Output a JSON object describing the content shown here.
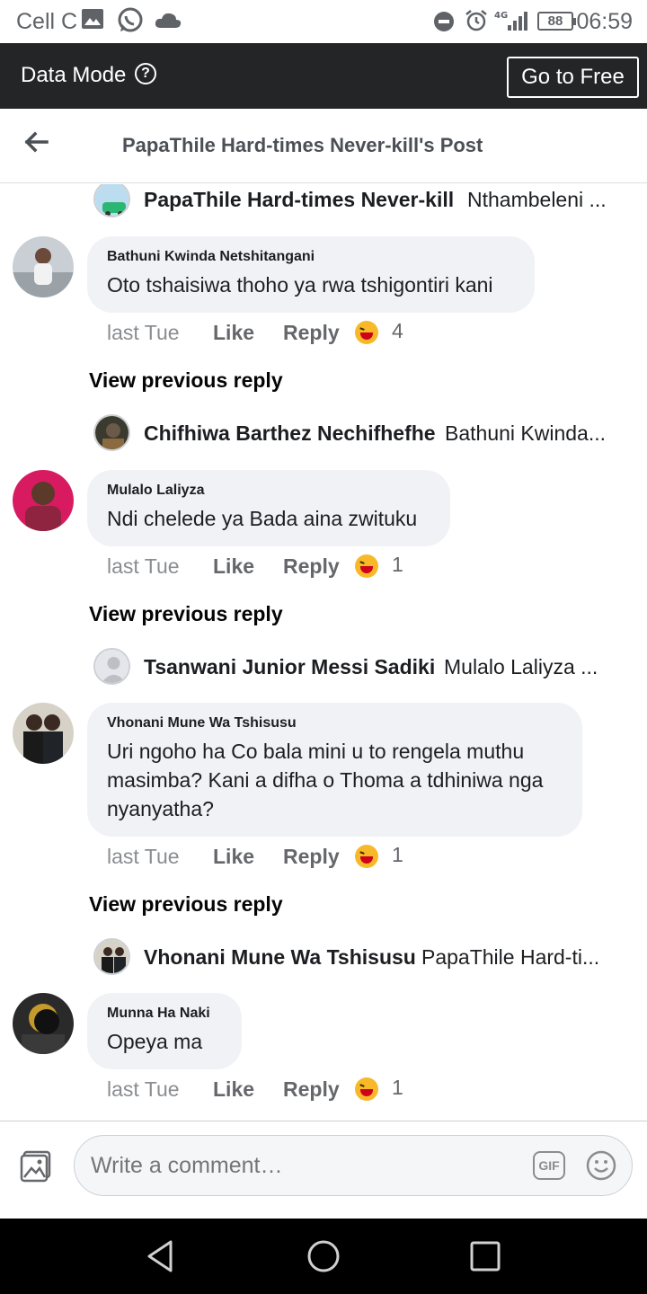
{
  "status_bar": {
    "carrier": "Cell C",
    "battery": "88",
    "network": "4G",
    "time": "06:59"
  },
  "data_mode": {
    "label": "Data Mode",
    "help": "?",
    "button": "Go to Free"
  },
  "header": {
    "title": "PapaThile Hard-times Never-kill's Post"
  },
  "comments": [
    {
      "reply_preview": {
        "name": "PapaThile Hard-times Never-kill",
        "text": "Nthambeleni ..."
      },
      "author": "Bathuni Kwinda Netshitangani",
      "text": "Oto tshaisiwa thoho ya rwa tshigontiri kani",
      "time": "last Tue",
      "like": "Like",
      "reply": "Reply",
      "reactions": "4"
    },
    {
      "view_previous": "View previous reply",
      "reply_preview": {
        "name": "Chifhiwa Barthez Nechifhefhe",
        "text": "Bathuni Kwinda..."
      },
      "author": "Mulalo Laliyza",
      "text": "Ndi chelede ya Bada aina zwituku",
      "time": "last Tue",
      "like": "Like",
      "reply": "Reply",
      "reactions": "1"
    },
    {
      "view_previous": "View previous reply",
      "reply_preview": {
        "name": "Tsanwani Junior Messi Sadiki",
        "text": "Mulalo Laliyza ..."
      },
      "author": "Vhonani Mune Wa Tshisusu",
      "text": "Uri ngoho ha Co bala mini u to rengela muthu masimba? Kani a difha o Thoma a tdhiniwa nga nyanyatha?",
      "time": "last Tue",
      "like": "Like",
      "reply": "Reply",
      "reactions": "1"
    },
    {
      "view_previous": "View previous reply",
      "reply_preview": {
        "name": "Vhonani Mune Wa Tshisusu",
        "text": "PapaThile Hard-ti..."
      },
      "author": "Munna Ha Naki",
      "text": "Opeya ma",
      "time": "last Tue",
      "like": "Like",
      "reply": "Reply",
      "reactions": "1"
    }
  ],
  "composer": {
    "placeholder": "Write a comment…",
    "gif": "GIF"
  },
  "icons": {
    "back": "arrow-left-icon",
    "photo": "photo-icon",
    "gif": "gif-icon",
    "emoji": "smile-icon",
    "reaction": "haha-icon",
    "nav": [
      "back-triangle-icon",
      "home-circle-icon",
      "recents-square-icon"
    ]
  },
  "colors": {
    "data_bar": "#242526",
    "bubble": "#f0f2f5",
    "reaction": "#f7b928"
  }
}
